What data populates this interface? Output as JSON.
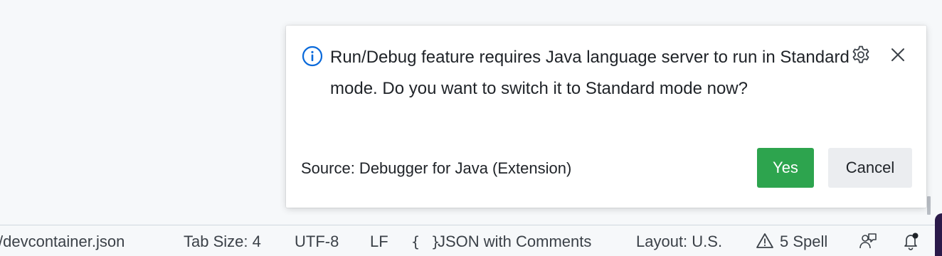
{
  "notification": {
    "message": "Run/Debug feature requires Java language server to run in Standard mode. Do you want to switch it to Standard mode now?",
    "source": "Source: Debugger for Java (Extension)",
    "buttons": {
      "yes": "Yes",
      "cancel": "Cancel"
    },
    "icons": {
      "severity": "info-icon",
      "settings": "gear-icon",
      "close": "close-icon"
    },
    "colors": {
      "info": "#0969da",
      "primary_button": "#2da44e",
      "secondary_button": "#ebedf0"
    }
  },
  "statusbar": {
    "file_path": "/devcontainer.json",
    "tab_size": "Tab Size: 4",
    "encoding": "UTF-8",
    "eol": "LF",
    "language_icon": "{ }",
    "language": "JSON with Comments",
    "layout": "Layout: U.S.",
    "spell": "5 Spell",
    "icons": {
      "spell": "warning-icon",
      "feedback": "feedback-icon",
      "notifications": "bell-icon"
    }
  }
}
